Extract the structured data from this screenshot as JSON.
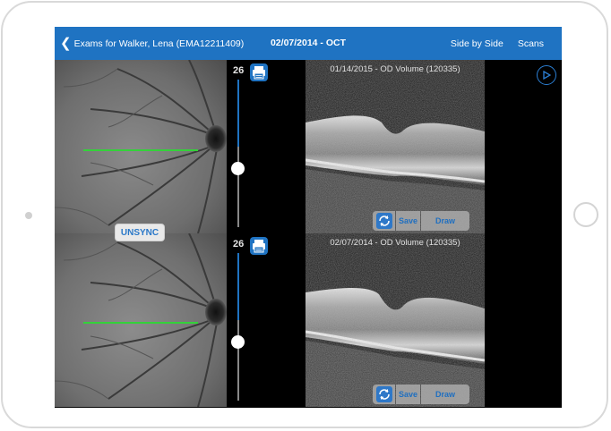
{
  "nav": {
    "back_label": "Exams for Walker, Lena (EMA12211409)",
    "title": "02/07/2014 - OCT",
    "side_by_side": "Side by Side",
    "scans": "Scans"
  },
  "top_pane": {
    "slice_number": "26",
    "oct_label": "01/14/2015 - OD Volume (120335)",
    "save_label": "Save",
    "draw_label": "Draw"
  },
  "bottom_pane": {
    "slice_number": "26",
    "oct_label": "02/07/2014 - OD Volume (120335)",
    "save_label": "Save",
    "draw_label": "Draw"
  },
  "unsync_label": "UNSYNC",
  "colors": {
    "nav_bar": "#1f73c2",
    "slider_track": "#1f73c2",
    "scan_line": "#34d13a",
    "button_text": "#1f6fc0"
  },
  "icons": [
    "chevron-left-icon",
    "printer-icon",
    "play-icon",
    "sync-icon"
  ]
}
